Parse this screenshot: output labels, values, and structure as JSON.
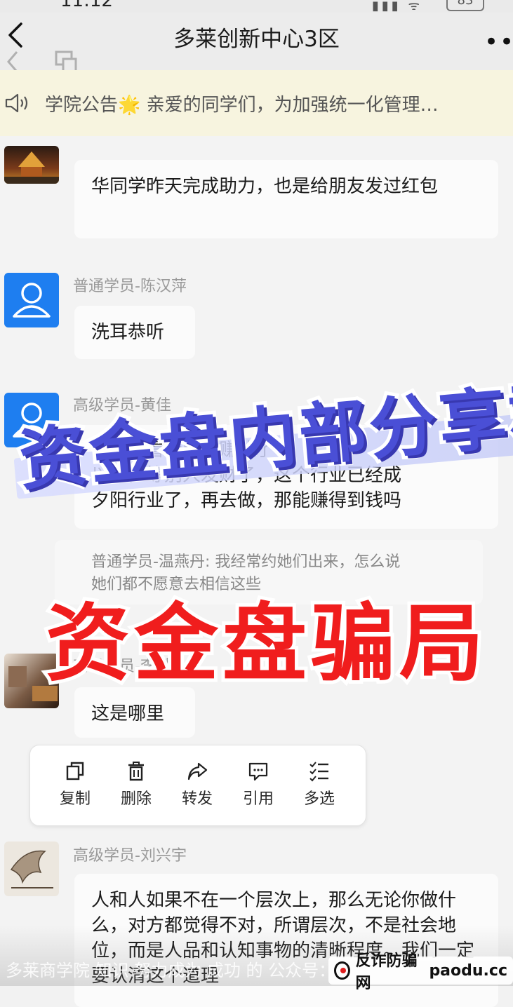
{
  "status_bar": {
    "time": "11:12",
    "battery": "83"
  },
  "header": {
    "title": "多莱创新中心3区",
    "more": "•••"
  },
  "announcement": {
    "label": "学院公告",
    "emoji": "🌟",
    "text": "亲爱的同学们，为加强统一化管理…"
  },
  "messages": [
    {
      "sender": "",
      "text": "华同学昨天完成助力，也是给朋友发过红包"
    },
    {
      "sender": "普通学员-陈汉萍",
      "text": "洗耳恭听"
    },
    {
      "sender": "高级学员-黄佳",
      "text": "以后，看看别人赚钱了\n以后，等别人发财了，这个行业已经成\n夕阳行业了，再去做，那能赚得到钱吗"
    },
    {
      "quote": "普通学员-温燕丹: 我经常约她们出来，怎么说\n她们都不愿意去相信这些"
    },
    {
      "sender": "高级学员-李斌",
      "text": "这是哪里"
    },
    {
      "sender": "高级学员-刘兴宇",
      "text": "人和人如果不在一个层次上，那么无论你做什么，对方都觉得不对，所谓层次，不是社会地位，而是人品和认知事物的清晰程度。我们一定要认清这个道理"
    }
  ],
  "context_menu": [
    "复制",
    "删除",
    "转发",
    "引用",
    "多选"
  ],
  "overlays": {
    "banner": "资金盘内部分享群",
    "stamp": "资金盘骗局"
  },
  "footer": {
    "left_watermark": "多莱商学院 知识 努力成为 成功 的 公众号：",
    "site_cn": "反诈防骗网",
    "site_en": "paodu.cc"
  },
  "colors": {
    "avatar_blue": "#1e7ef0",
    "stamp_red": "#f01d1d",
    "banner_purple": "#4a4fd6",
    "notice_bg": "#f7f4df"
  }
}
